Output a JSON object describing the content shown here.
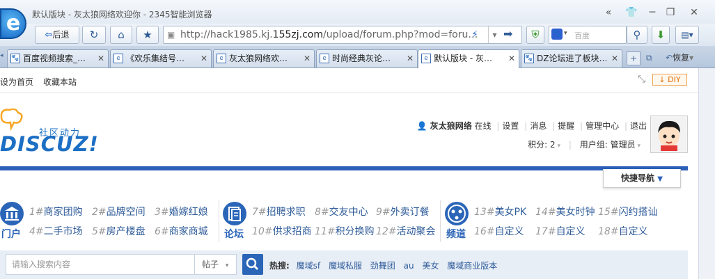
{
  "window": {
    "title": "默认版块 - 灰太狼网络欢迎你 - 2345智能浏览器"
  },
  "toolbar": {
    "back_label": "后退",
    "address_prefix": "http://hack1985.kj.",
    "address_domain": "155zj.com",
    "address_suffix": "/upload/forum.php?mod=foru…",
    "search_placeholder": "百度"
  },
  "tabs": [
    {
      "label": "百度视频搜索_…",
      "icon": "paw-icon",
      "active": false
    },
    {
      "label": "《欢乐集结号…",
      "icon": "page-icon",
      "active": false
    },
    {
      "label": "灰太狼网络欢…",
      "icon": "page-icon",
      "active": false
    },
    {
      "label": "时尚经典灰论…",
      "icon": "page-icon",
      "active": false
    },
    {
      "label": "默认版块 - 灰…",
      "icon": "page-icon",
      "active": true
    },
    {
      "label": "DZ论坛进了板块…",
      "icon": "paw-icon",
      "active": false
    }
  ],
  "tabbar_extra": {
    "restore_label": "恢复"
  },
  "topbar": {
    "set_home": "设为首页",
    "bookmark": "收藏本站",
    "diy_label": "DIY"
  },
  "header": {
    "logo_text": "DISCUZ!",
    "community": "社区动力",
    "username": "灰太狼网络",
    "status": "在线",
    "links": [
      "设置",
      "消息",
      "提醒",
      "管理中心",
      "退出"
    ],
    "points_label": "积分: 2",
    "group_label": "用户组: 管理员",
    "quick_nav": "快捷导航"
  },
  "nav": {
    "groups": [
      {
        "label": "门户",
        "icon": "portal-icon",
        "items": [
          {
            "num": "1",
            "text": "商家团购"
          },
          {
            "num": "2",
            "text": "品牌空间"
          },
          {
            "num": "3",
            "text": "婚嫁红娘"
          },
          {
            "num": "4",
            "text": "二手市场"
          },
          {
            "num": "5",
            "text": "房产楼盘"
          },
          {
            "num": "6",
            "text": "商家商城"
          }
        ]
      },
      {
        "label": "论坛",
        "icon": "forum-icon",
        "items": [
          {
            "num": "7",
            "text": "招聘求职"
          },
          {
            "num": "8",
            "text": "交友中心"
          },
          {
            "num": "9",
            "text": "外卖订餐"
          },
          {
            "num": "10",
            "text": "供求招商"
          },
          {
            "num": "11",
            "text": "积分换购"
          },
          {
            "num": "12",
            "text": "活动聚会"
          }
        ]
      },
      {
        "label": "频道",
        "icon": "channel-icon",
        "items": [
          {
            "num": "13",
            "text": "美女PK"
          },
          {
            "num": "14",
            "text": "美女时钟"
          },
          {
            "num": "15",
            "text": "闪约搭讪"
          },
          {
            "num": "16",
            "text": "自定义"
          },
          {
            "num": "17",
            "text": "自定义"
          },
          {
            "num": "18",
            "text": "自定义"
          }
        ]
      }
    ]
  },
  "search": {
    "placeholder": "请输入搜索内容",
    "type": "帖子",
    "hot_label": "热搜:",
    "hot_words": [
      "魔域sf",
      "魔域私服",
      "劲舞团",
      "au",
      "美女",
      "魔域商业版本"
    ]
  }
}
